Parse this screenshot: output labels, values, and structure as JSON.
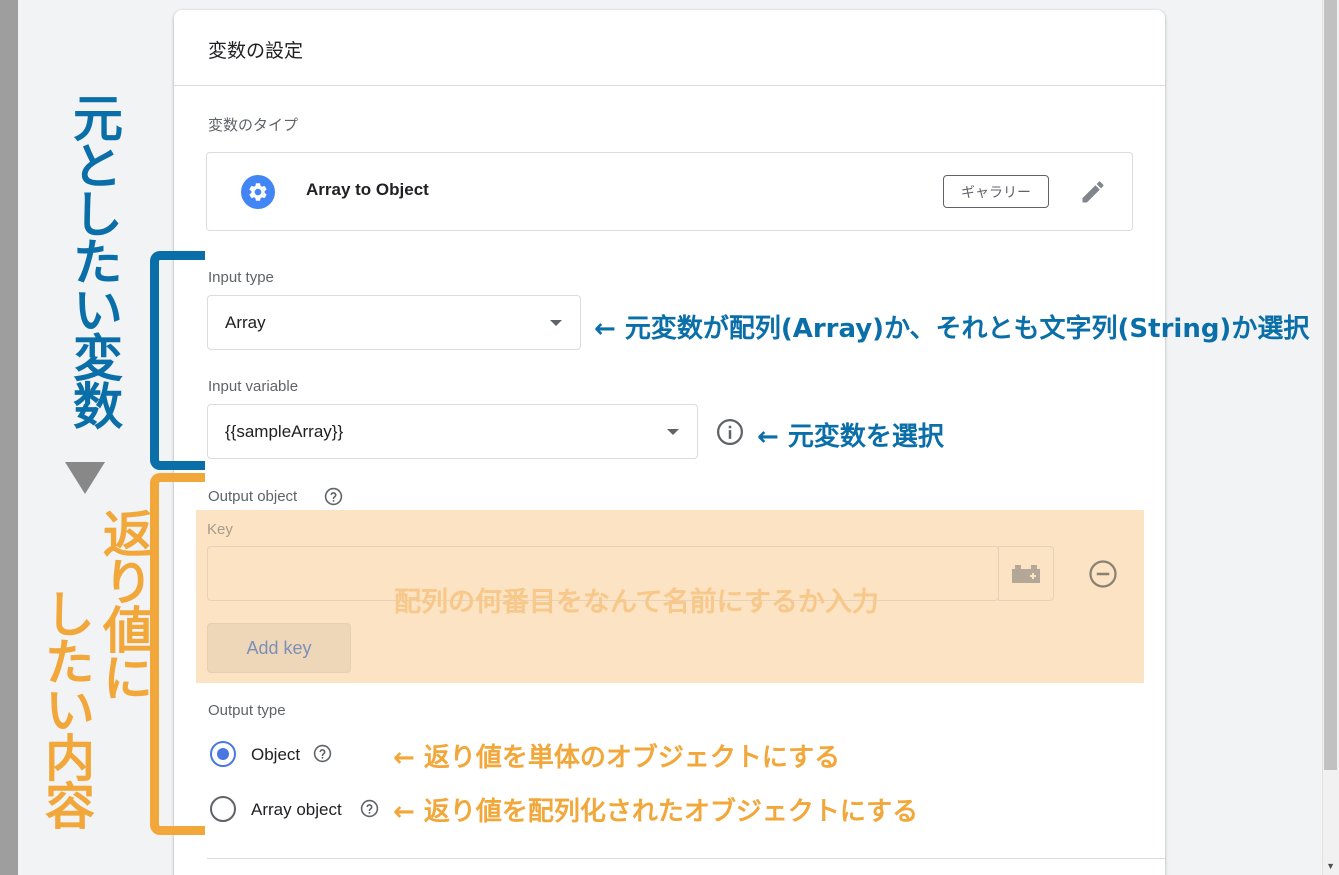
{
  "card": {
    "title": "変数の設定",
    "variable_type_label": "変数のタイプ",
    "variable_type_name": "Array to Object",
    "gallery_chip": "ギャラリー",
    "input_type": {
      "label": "Input type",
      "value": "Array"
    },
    "input_variable": {
      "label": "Input variable",
      "value": "{{sampleArray}}"
    },
    "output_object": {
      "label": "Output object",
      "key_label": "Key",
      "key_value": "",
      "add_key_button": "Add key"
    },
    "output_type": {
      "label": "Output type",
      "options": [
        {
          "label": "Object",
          "checked": true
        },
        {
          "label": "Array object",
          "checked": false
        }
      ]
    }
  },
  "annotations": {
    "input_type_note": "← 元変数が配列(Array)か、それとも文字列(String)か選択",
    "input_variable_note": "← 元変数を選択",
    "key_note": "配列の何番目をなんて名前にするか入力",
    "object_note": "← 返り値を単体のオブジェクトにする",
    "array_object_note": "← 返り値を配列化されたオブジェクトにする",
    "source_variable_vertical": "元としたい変数",
    "return_value_vertical_1": "返り値に",
    "return_value_vertical_2": "したい内容"
  },
  "colors": {
    "annotation_blue": "#0a6fa8",
    "annotation_orange": "#f2a73a",
    "gear_blue": "#4285f4",
    "radio_blue": "#4a78e0",
    "highlight_panel": "#fbe3c4"
  }
}
